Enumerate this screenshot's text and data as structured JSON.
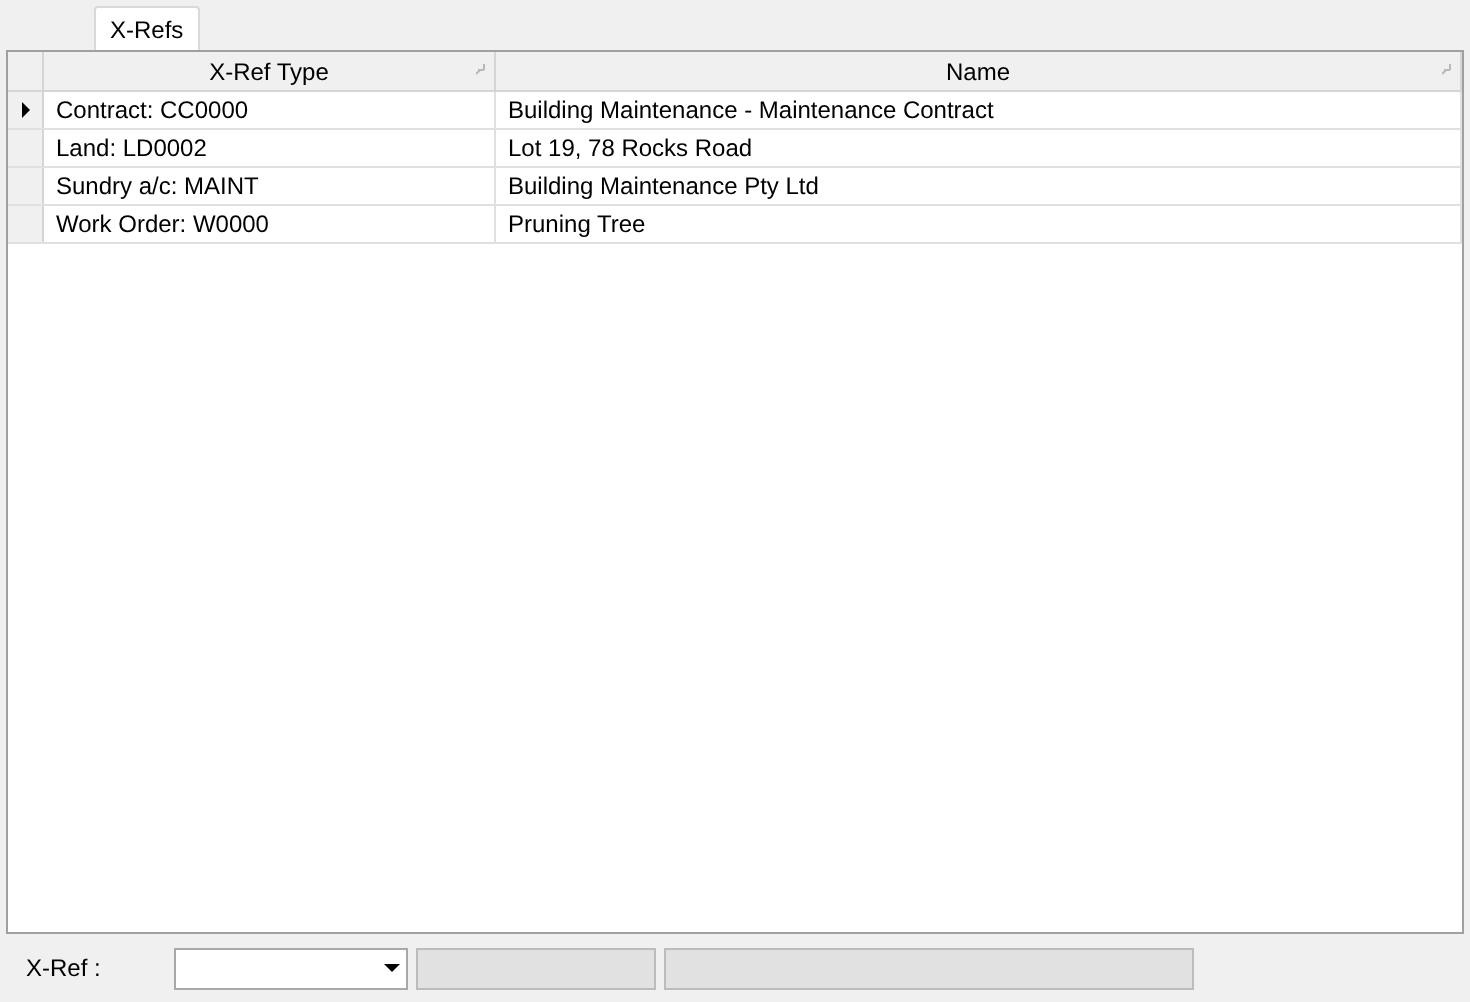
{
  "tabs": [
    {
      "label": "X-Refs",
      "selected": true
    }
  ],
  "table": {
    "columns": [
      "X-Ref Type",
      "Name"
    ],
    "rows": [
      {
        "selected": true,
        "cells": [
          "Contract: CC0000",
          "Building Maintenance - Maintenance Contract"
        ]
      },
      {
        "selected": false,
        "cells": [
          "Land: LD0002",
          "Lot 19, 78 Rocks Road"
        ]
      },
      {
        "selected": false,
        "cells": [
          "Sundry a/c: MAINT",
          "Building Maintenance Pty Ltd"
        ]
      },
      {
        "selected": false,
        "cells": [
          "Work Order: W0000",
          "Pruning Tree"
        ]
      }
    ]
  },
  "footer": {
    "label": "X-Ref :",
    "fields": [
      {
        "kind": "dropdown",
        "disabled": false
      },
      {
        "kind": "text",
        "disabled": true
      },
      {
        "kind": "text",
        "disabled": true
      }
    ]
  }
}
